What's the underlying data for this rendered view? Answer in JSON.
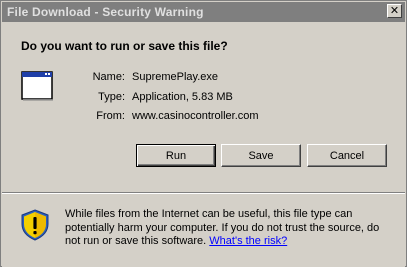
{
  "window": {
    "title": "File Download - Security Warning",
    "close_label": "✕"
  },
  "dialog": {
    "question": "Do you want to run or save this file?",
    "fields": [
      {
        "label": "Name:",
        "value": "SupremePlay.exe"
      },
      {
        "label": "Type:",
        "value": "Application, 5.83 MB"
      },
      {
        "label": "From:",
        "value": "www.casinocontroller.com"
      }
    ],
    "buttons": {
      "run": "Run",
      "save": "Save",
      "cancel": "Cancel"
    }
  },
  "warning": {
    "text": "While files from the Internet can be useful, this file type can potentially harm your computer. If you do not trust the source, do not run or save this software. ",
    "link": "What's the risk?"
  },
  "icons": {
    "file": "application-window-icon",
    "shield": "security-shield-icon",
    "close": "close-icon"
  },
  "colors": {
    "titlebar_inactive": "#7f7f7f",
    "dialog_face": "#d4d0c8",
    "link": "#0000ff",
    "shield_yellow": "#f4d000",
    "shield_blue": "#2c5fbd"
  }
}
